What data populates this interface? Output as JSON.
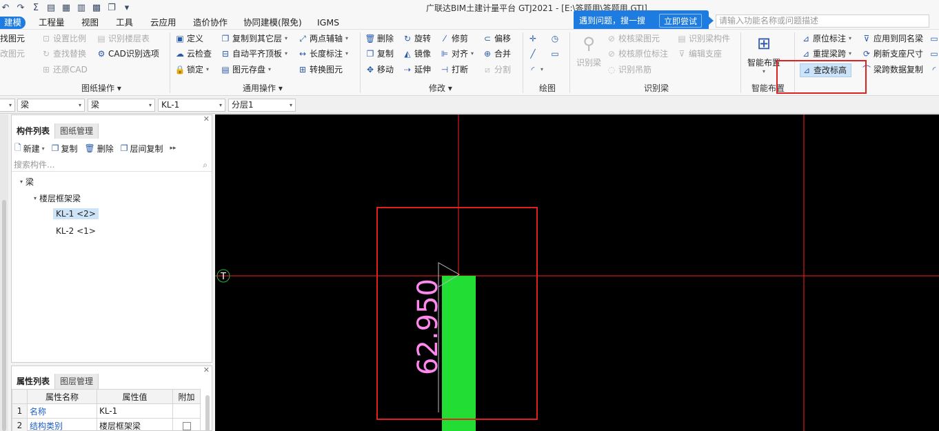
{
  "window": {
    "title": "广联达BIM土建计量平台 GTJ2021 - [E:\\答题用\\答题用.GTJ]"
  },
  "menu": {
    "tabs": [
      "建模",
      "工程量",
      "视图",
      "工具",
      "云应用",
      "造价协作",
      "协同建模(限免)",
      "IGMS"
    ]
  },
  "help": {
    "text": "遇到问题，搜一搜",
    "button": "立即尝试",
    "search_placeholder": "请输入功能名称或问题描述"
  },
  "ribbon": {
    "drawing_ops": {
      "label": "图纸操作",
      "items": [
        "找图元",
        "设置比例",
        "识别楼层表",
        "改图元",
        "查找替换",
        "CAD识别选项",
        "还原CAD"
      ]
    },
    "common_ops": {
      "label": "通用操作",
      "items": [
        "定义",
        "复制到其它层",
        "两点辅轴",
        "云检查",
        "自动平齐顶板",
        "长度标注",
        "锁定",
        "图元存盘",
        "转换图元"
      ]
    },
    "modify": {
      "label": "修改",
      "items": [
        "删除",
        "旋转",
        "修剪",
        "偏移",
        "复制",
        "镜像",
        "对齐",
        "合并",
        "移动",
        "延伸",
        "打断",
        "分割"
      ]
    },
    "draw": {
      "label": "绘图"
    },
    "recognize_beam": {
      "label": "识别梁",
      "items": [
        "识别梁",
        "校核梁图元",
        "识别梁构件",
        "校核原位标注",
        "编辑支座",
        "识别吊筋"
      ]
    },
    "smart_layout": {
      "label": "智能布置",
      "button": "智能布置"
    },
    "beam_ops": {
      "items": [
        "原位标注",
        "应用到同名梁",
        "重提梁跨",
        "刷新支座尺寸",
        "查改标高",
        "梁跨数据复制"
      ]
    }
  },
  "filters": [
    "梁",
    "梁",
    "KL-1",
    "分层1"
  ],
  "component_panel": {
    "tabs": [
      "构件列表",
      "图纸管理"
    ],
    "toolbar": [
      "新建",
      "复制",
      "删除",
      "层间复制"
    ],
    "search_placeholder": "搜索构件...",
    "tree": {
      "root": "梁",
      "child": "楼层框架梁",
      "items": [
        "KL-1 <2>",
        "KL-2 <1>"
      ]
    }
  },
  "property_panel": {
    "tabs": [
      "属性列表",
      "图层管理"
    ],
    "headers": [
      "属性名称",
      "属性值",
      "附加"
    ],
    "rows": [
      {
        "idx": "1",
        "name": "名称",
        "value": "KL-1"
      },
      {
        "idx": "2",
        "name": "结构类别",
        "value": "楼层框架梁"
      }
    ]
  },
  "canvas": {
    "axis_marker": "T",
    "elevation_label": "62.950",
    "colors": {
      "background": "#000000",
      "axis": "#ff2020",
      "beam": "#22dd33",
      "label": "#ff88ee",
      "box": "#e02020"
    }
  }
}
